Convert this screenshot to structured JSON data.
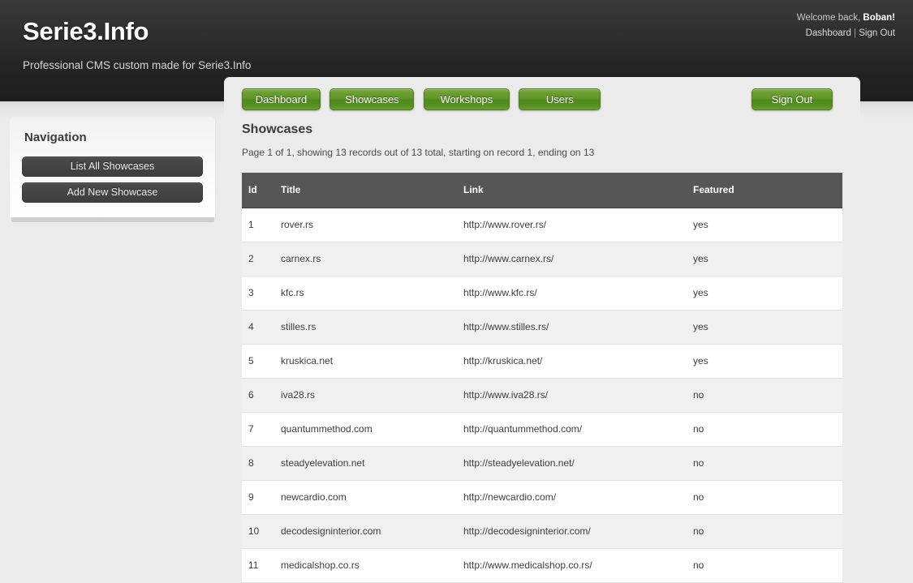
{
  "header": {
    "brand_title": "Serie3.Info",
    "tagline": "Professional CMS custom made for Serie3.Info",
    "welcome_prefix": "Welcome back, ",
    "user_name": "Boban!",
    "dashboard_link": "Dashboard",
    "separator": "|",
    "signout_link": "Sign Out"
  },
  "tabs": {
    "dashboard": "Dashboard",
    "showcases": "Showcases",
    "workshops": "Workshops",
    "users": "Users",
    "signout": "Sign Out"
  },
  "sidebar": {
    "title": "Navigation",
    "buttons": [
      {
        "label": "List All Showcases"
      },
      {
        "label": "Add New Showcase"
      }
    ]
  },
  "main": {
    "page_title": "Showcases",
    "page_meta": "Page 1 of 1, showing 13 records out of 13 total, starting on record 1, ending on 13"
  },
  "table": {
    "columns": [
      "Id",
      "Title",
      "Link",
      "Featured"
    ],
    "rows": [
      {
        "id": "1",
        "title": "rover.rs",
        "link": "http://www.rover.rs/",
        "featured": "yes"
      },
      {
        "id": "2",
        "title": "carnex.rs",
        "link": "http://www.carnex.rs/",
        "featured": "yes"
      },
      {
        "id": "3",
        "title": "kfc.rs",
        "link": "http://www.kfc.rs/",
        "featured": "yes"
      },
      {
        "id": "4",
        "title": "stilles.rs",
        "link": "http://www.stilles.rs/",
        "featured": "yes"
      },
      {
        "id": "5",
        "title": "kruskica.net",
        "link": "http://kruskica.net/",
        "featured": "yes"
      },
      {
        "id": "6",
        "title": "iva28.rs",
        "link": "http://www.iva28.rs/",
        "featured": "no"
      },
      {
        "id": "7",
        "title": "quantummethod.com",
        "link": "http://quantummethod.com/",
        "featured": "no"
      },
      {
        "id": "8",
        "title": "steadyelevation.net",
        "link": "http://steadyelevation.net/",
        "featured": "no"
      },
      {
        "id": "9",
        "title": "newcardio.com",
        "link": "http://newcardio.com/",
        "featured": "no"
      },
      {
        "id": "10",
        "title": "decodesigninterior.com",
        "link": "http://decodesigninterior.com/",
        "featured": "no"
      },
      {
        "id": "11",
        "title": "medicalshop.co.rs",
        "link": "http://www.medicalshop.co.rs/",
        "featured": "no"
      }
    ]
  },
  "colors": {
    "header_dark": "#222222",
    "page_bg": "#ebebeb",
    "accent_green": "#5f9328",
    "table_header": "#565656",
    "dark_button": "#444444"
  }
}
